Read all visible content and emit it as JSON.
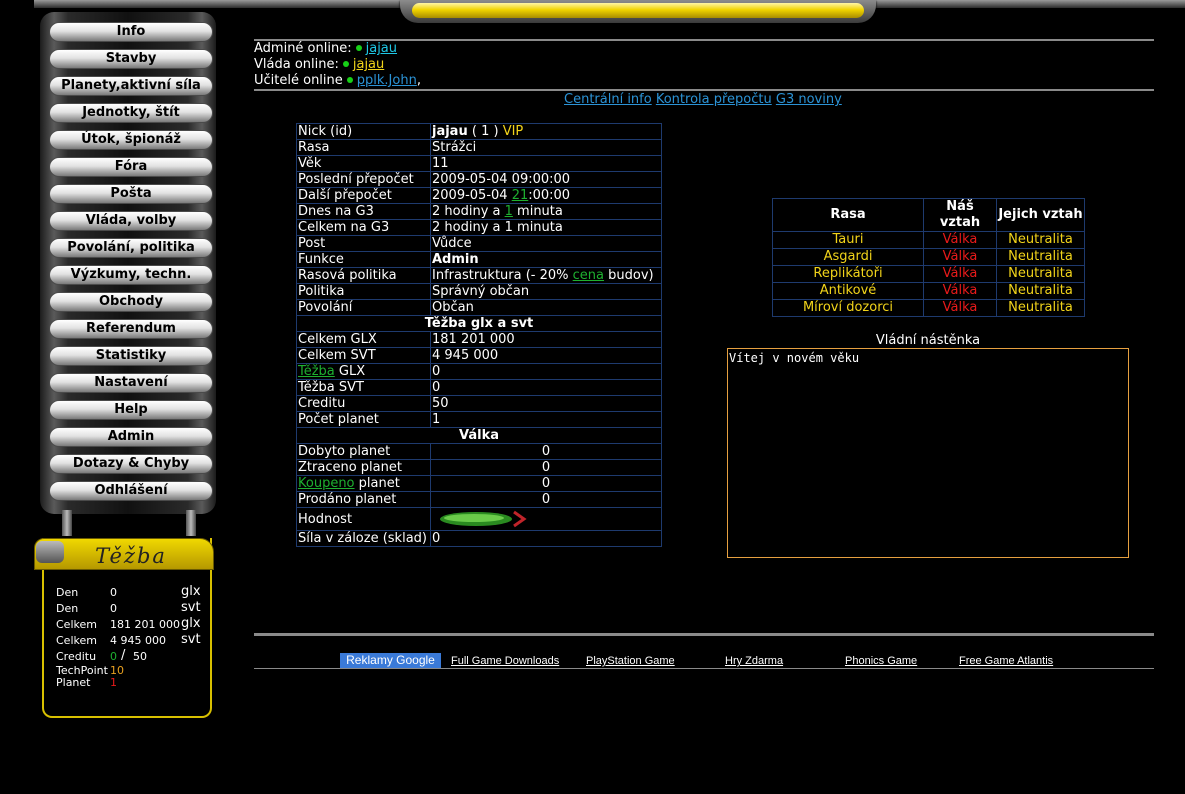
{
  "menu": [
    "Info",
    "Stavby",
    "Planety,aktivní síla",
    "Jednotky, štít",
    "Útok, špionáž",
    "Fóra",
    "Pošta",
    "Vláda, volby",
    "Povolání, politika",
    "Výzkumy, techn.",
    "Obchody",
    "Referendum",
    "Statistiky",
    "Nastavení",
    "Help",
    "Admin",
    "Dotazy & Chyby",
    "Odhlášení"
  ],
  "tezba": {
    "title": "Těžba",
    "den_label": "Den",
    "den_glx": "0",
    "den_svt": "0",
    "celkem_label": "Celkem",
    "celkem_glx": "181 201 000",
    "celkem_svt": "4 945 000",
    "unit_glx": "glx",
    "unit_svt": "svt",
    "creditu_label": "Creditu",
    "creditu_value": "0",
    "creditu_sep": "/",
    "creditu_max": "50",
    "techpoint_label": "TechPoint",
    "techpoint_value": "10",
    "planet_label": "Planet",
    "planet_value": "1"
  },
  "online": {
    "admins_label": "Adminé online:",
    "admins_name": "jajau",
    "vlada_label": "Vláda online:",
    "vlada_name": "jajau",
    "ucitele_label": "Učitelé online",
    "ucitele_name": "pplk.John",
    "ucitele_suffix": ","
  },
  "links": {
    "central": "Centrální info",
    "kontrola": "Kontrola přepočtu",
    "noviny": "G3 noviny"
  },
  "player": {
    "nick_label": "Nick (id)",
    "nick": "jajau",
    "id_open": "( 1 )",
    "vip": "VIP",
    "rasa_label": "Rasa",
    "rasa": "Strážci",
    "vek_label": "Věk",
    "vek": "11",
    "posledni_label": "Poslední přepočet",
    "posledni": "2009-05-04 09:00:00",
    "dalsi_label": "Další přepočet",
    "dalsi_pre": "2009-05-04 ",
    "dalsi_hour": "21",
    "dalsi_post": ":00:00",
    "dnes_label": "Dnes na G3",
    "dnes_pre": "2 hodiny a ",
    "dnes_min": "1",
    "dnes_post": " minuta",
    "celkem_label": "Celkem na G3",
    "celkem": "2 hodiny a 1 minuta",
    "post_label": "Post",
    "post": "Vůdce",
    "funkce_label": "Funkce",
    "funkce": "Admin",
    "rasova_label": "Rasová politika",
    "rasova_pre": "Infrastruktura (- 20% ",
    "rasova_link": "cena",
    "rasova_post": " budov)",
    "politika_label": "Politika",
    "politika": "Správný občan",
    "povolani_label": "Povolání",
    "povolani": "Občan",
    "tezba_section": "Těžba glx a svt",
    "celkem_glx_label": "Celkem GLX",
    "celkem_glx": "181 201 000",
    "celkem_svt_label": "Celkem SVT",
    "celkem_svt": "4 945 000",
    "tezba_glx_link": "Těžba",
    "tezba_glx_suffix": " GLX",
    "tezba_glx": "0",
    "tezba_svt_label": "Těžba SVT",
    "tezba_svt": "0",
    "creditu_label": "Creditu",
    "creditu": "50",
    "pocet_planet_label": "Počet planet",
    "pocet_planet": "1",
    "valka_section": "Válka",
    "dobyto_label": "Dobyto planet",
    "dobyto": "0",
    "ztraceno_label": "Ztraceno planet",
    "ztraceno": "0",
    "koupeno_link": "Koupeno",
    "koupeno_suffix": " planet",
    "koupeno": "0",
    "prodano_label": "Prodáno planet",
    "prodano": "0",
    "hodnost_label": "Hodnost",
    "sila_label": "Síla v záloze (sklad)",
    "sila": "0"
  },
  "relations": {
    "headers": [
      "Rasa",
      "Náš vztah",
      "Jejich vztah"
    ],
    "rows": [
      {
        "rasa": "Tauri",
        "nas": "Válka",
        "jejich": "Neutralita"
      },
      {
        "rasa": "Asgardi",
        "nas": "Válka",
        "jejich": "Neutralita"
      },
      {
        "rasa": "Replikátoři",
        "nas": "Válka",
        "jejich": "Neutralita"
      },
      {
        "rasa": "Antikové",
        "nas": "Válka",
        "jejich": "Neutralita"
      },
      {
        "rasa": "Míroví dozorci",
        "nas": "Válka",
        "jejich": "Neutralita"
      }
    ]
  },
  "board": {
    "title": "Vládní nástěnka",
    "text": "Vítej v novém věku"
  },
  "ads": {
    "google": "Reklamy Google",
    "items": [
      "Full Game Downloads",
      "PlayStation Game",
      "Hry Zdarma",
      "Phonics Game",
      "Free Game Atlantis"
    ]
  },
  "colors": {
    "link_cyan": "#1ec8e6",
    "link_yellow": "#f2d41a",
    "war_red": "#e81a1a",
    "table_border": "#1e3a6e",
    "online_dot": "#17d017"
  }
}
